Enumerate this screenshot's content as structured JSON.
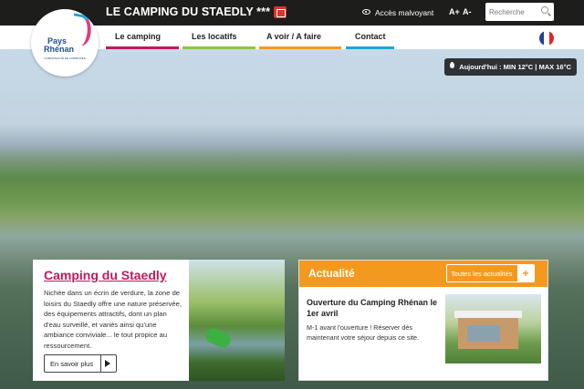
{
  "header": {
    "site_title": "LE CAMPING DU STAEDLY ***",
    "accessibility_label": "Accès malvoyant",
    "font_increase": "A+",
    "font_decrease": "A-",
    "search_placeholder": "Recherche"
  },
  "logo": {
    "line1": "Pays",
    "line2": "Rhénan",
    "tagline": "COMMUNAUTÉ DE COMMUNES"
  },
  "nav": {
    "items": [
      {
        "label": "Le camping",
        "color": "#c2185b"
      },
      {
        "label": "Les locatifs",
        "color": "#8dc63f"
      },
      {
        "label": "A voir / A faire",
        "color": "#f39a1e"
      },
      {
        "label": "Contact",
        "color": "#1aa7d6"
      }
    ]
  },
  "weather": {
    "text": "Aujourd'hui : MIN 12°C | MAX 16°C"
  },
  "camping_card": {
    "title": "Camping du Staedly",
    "body": "Nichée dans un écrin de verdure, la zone de loisirs du Staedly offre une nature préservée, des équipements attractifs, dont un plan d'eau surveillé, et variés ainsi qu'une ambiance conviviale... le tout propice au ressourcement.",
    "button_label": "En savoir plus"
  },
  "news_card": {
    "title": "Actualité",
    "all_news_label": "Toutes les actualités",
    "plus": "+",
    "item_title": "Ouverture du Camping Rhénan le 1er avril",
    "item_text": "M-1 avant l'ouverture ! Réserver dès maintenant votre séjour depuis ce site."
  },
  "colors": {
    "topbar": "#1d1d1b",
    "brand_pink": "#c2185b",
    "accent_orange": "#f39a1e"
  }
}
